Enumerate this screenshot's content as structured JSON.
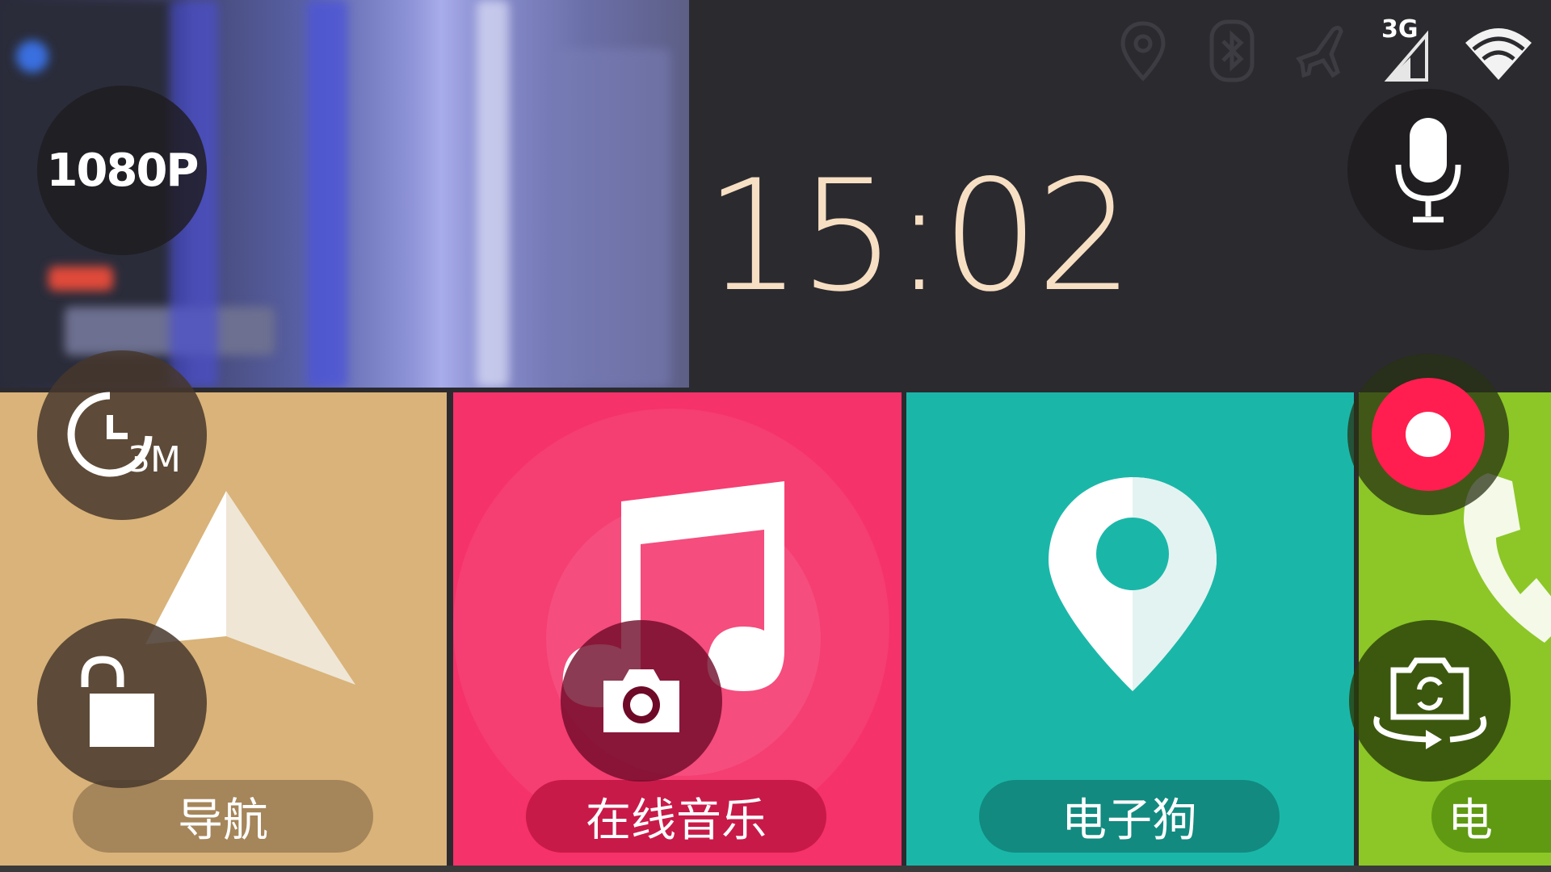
{
  "clock": {
    "time": "15:02"
  },
  "status_bar": {
    "network_label": "3G",
    "icons": [
      "location-icon",
      "bluetooth-icon",
      "airplane-icon",
      "signal-icon",
      "wifi-icon"
    ]
  },
  "overlay": {
    "resolution_label": "1080P",
    "loop_duration_label": "3M"
  },
  "tiles": [
    {
      "label": "导航",
      "color": "#d9b379",
      "pill": "#a5855a"
    },
    {
      "label": "在线音乐",
      "color": "#f5326a",
      "pill": "#c81a48"
    },
    {
      "label": "电子狗",
      "color": "#1ab7a9",
      "pill": "#128a80"
    },
    {
      "label": "电",
      "color": "#8cc727",
      "pill": "#5f9a12"
    }
  ],
  "colors": {
    "record": "#ff1e4f",
    "clock": "#f7dfc4",
    "background": "#2b2a2f"
  }
}
